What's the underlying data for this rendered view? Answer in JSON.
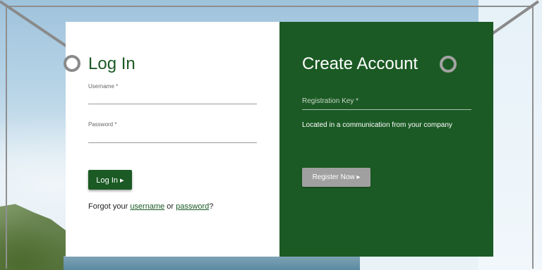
{
  "login": {
    "title": "Log In",
    "username_label": "Username *",
    "password_label": "Password *",
    "button_label": "Log In ▸",
    "forgot_prefix": "Forgot your ",
    "forgot_username": "username",
    "forgot_or": " or ",
    "forgot_password": "password",
    "forgot_suffix": "?"
  },
  "create": {
    "title": "Create Account",
    "registration_label": "Registration Key *",
    "registration_note": "Located in a communication from your company",
    "button_label": "Register Now ▸"
  },
  "colors": {
    "brand_green": "#1b5a24",
    "disabled_gray": "#a0a0a0"
  }
}
